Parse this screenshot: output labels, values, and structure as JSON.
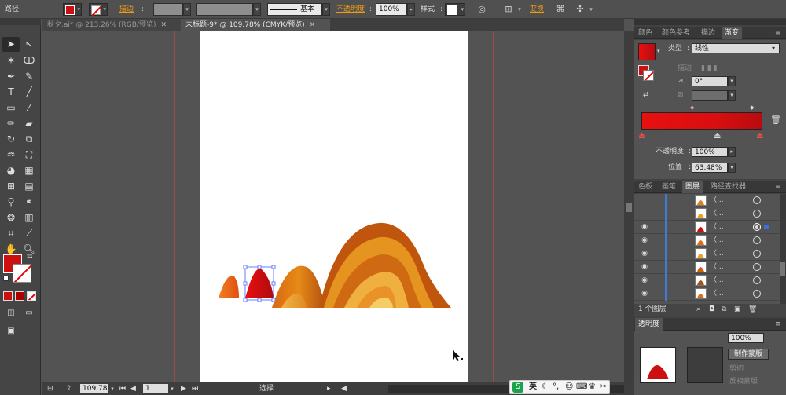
{
  "control_bar": {
    "path_label": "路径",
    "stroke_label": "描边",
    "stroke_style": "基本",
    "opacity_label": "不透明度",
    "opacity_value": "100%",
    "style_label": "样式",
    "transform_label": "变换",
    "fill_color": "#cc1010"
  },
  "tabs": [
    {
      "label": "秋夕.ai* @ 213.26% (RGB/预览)"
    },
    {
      "label": "未标题-9* @ 109.78% (CMYK/预览)"
    }
  ],
  "status": {
    "zoom": "109.78",
    "artboard": "1",
    "tool_label": "选择"
  },
  "color_panel": {
    "tabs": [
      "颜色",
      "颜色参考",
      "描边",
      "渐变"
    ],
    "type_label": "类型",
    "type_value": "线性",
    "stroke_label": "描边",
    "angle_value": "0°",
    "aspect_label": "比",
    "opacity_label": "不透明度",
    "opacity_value": "100%",
    "position_label": "位置",
    "position_value": "63.48%",
    "gradient_start": "#e81010",
    "gradient_end": "#b80c10"
  },
  "layers_panel": {
    "tabs": [
      "色板",
      "画笔",
      "图层",
      "路径查找器"
    ],
    "rows": [
      {
        "name": "〈...",
        "eye": false,
        "target_selected": false,
        "color": "#e87d10"
      },
      {
        "name": "〈...",
        "eye": false,
        "target_selected": false,
        "color": "#f0a020"
      },
      {
        "name": "〈...",
        "eye": true,
        "target_selected": true,
        "color": "#cc1010"
      },
      {
        "name": "〈...",
        "eye": true,
        "target_selected": false,
        "color": "#e86a10"
      },
      {
        "name": "〈...",
        "eye": true,
        "target_selected": false,
        "color": "#e8a030"
      },
      {
        "name": "〈...",
        "eye": true,
        "target_selected": false,
        "color": "#d06010"
      },
      {
        "name": "〈...",
        "eye": true,
        "target_selected": false,
        "color": "#b05010"
      },
      {
        "name": "〈...",
        "eye": true,
        "target_selected": false,
        "color": "#d07020"
      }
    ],
    "footer_count": "1 个图层"
  },
  "transparency_panel": {
    "tab": "透明度",
    "opacity_value": "100%",
    "make_mask": "制作蒙版",
    "clip": "剪切",
    "invert_mask": "反相蒙版"
  },
  "ime": {
    "label": "英"
  }
}
